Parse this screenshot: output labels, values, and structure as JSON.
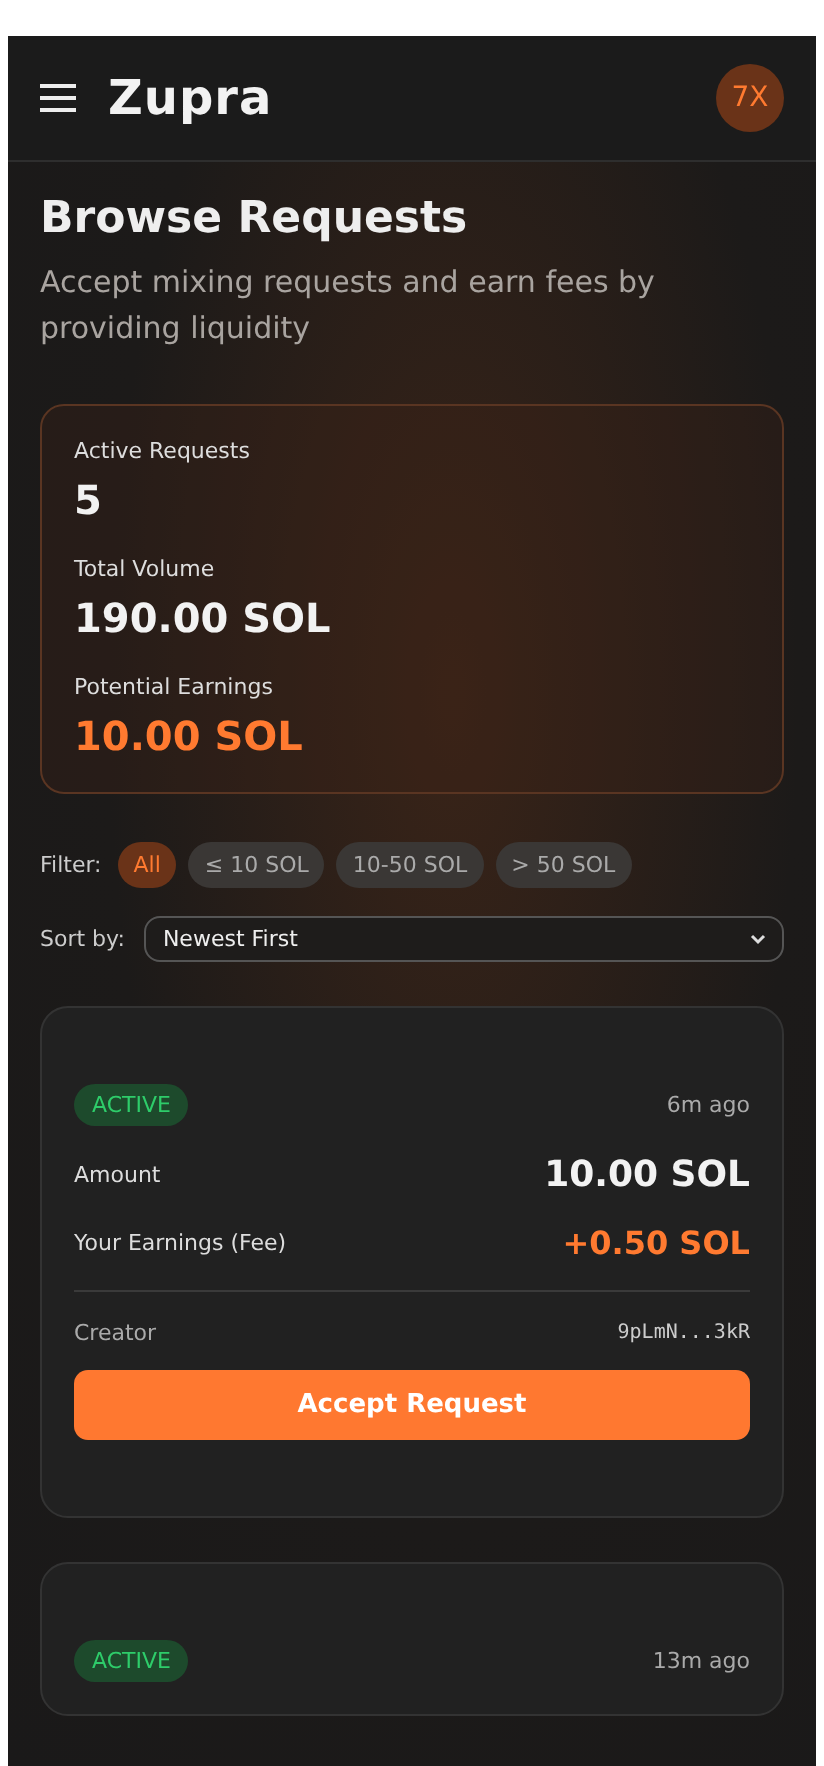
{
  "header": {
    "logo": "Zupra",
    "avatar": "7X"
  },
  "page": {
    "title": "Browse Requests",
    "subtitle": "Accept mixing requests and earn fees by providing liquidity"
  },
  "stats": [
    {
      "label": "Active Requests",
      "value": "5",
      "highlight": false
    },
    {
      "label": "Total Volume",
      "value": "190.00 SOL",
      "highlight": false
    },
    {
      "label": "Potential Earnings",
      "value": "10.00 SOL",
      "highlight": true
    }
  ],
  "filter": {
    "label": "Filter:",
    "options": [
      {
        "label": "All",
        "selected": true
      },
      {
        "label": "≤ 10 SOL",
        "selected": false
      },
      {
        "label": "10-50 SOL",
        "selected": false
      },
      {
        "label": "> 50 SOL",
        "selected": false
      }
    ]
  },
  "sort": {
    "label": "Sort by:",
    "value": "Newest First"
  },
  "requests": [
    {
      "status": "ACTIVE",
      "time": "6m ago",
      "amount_label": "Amount",
      "amount": "10.00 SOL",
      "earnings_label": "Your Earnings (Fee)",
      "earnings": "+0.50 SOL",
      "creator_label": "Creator",
      "creator": "9pLmN...3kR",
      "action": "Accept Request"
    },
    {
      "status": "ACTIVE",
      "time": "13m ago"
    }
  ]
}
